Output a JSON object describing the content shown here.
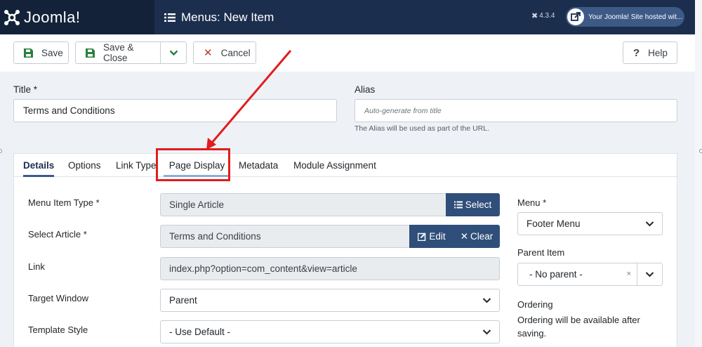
{
  "header": {
    "brand": "Joomla!",
    "page_title": "Menus: New Item",
    "version": "4.3.4",
    "site_link": "Your Joomla! Site hosted wit..."
  },
  "toolbar": {
    "save": "Save",
    "save_close": "Save & Close",
    "cancel": "Cancel",
    "help": "Help"
  },
  "form": {
    "title_label": "Title *",
    "title_value": "Terms and Conditions",
    "alias_label": "Alias",
    "alias_placeholder": "Auto-generate from title",
    "alias_hint": "The Alias will be used as part of the URL."
  },
  "tabs": [
    "Details",
    "Options",
    "Link Type",
    "Page Display",
    "Metadata",
    "Module Assignment"
  ],
  "details": {
    "menu_item_type_label": "Menu Item Type *",
    "menu_item_type_value": "Single Article",
    "select_button": "Select",
    "select_article_label": "Select Article *",
    "select_article_value": "Terms and Conditions",
    "edit_button": "Edit",
    "clear_button": "Clear",
    "link_label": "Link",
    "link_value": "index.php?option=com_content&view=article",
    "target_window_label": "Target Window",
    "target_window_value": "Parent",
    "template_style_label": "Template Style",
    "template_style_value": "- Use Default -"
  },
  "sidebar": {
    "menu_label": "Menu *",
    "menu_value": "Footer Menu",
    "parent_item_label": "Parent Item",
    "parent_item_value": "- No parent -",
    "ordering_label": "Ordering",
    "ordering_text": "Ordering will be available after saving."
  },
  "colors": {
    "header_bg": "#1c2e4e",
    "accent": "#2f4e7a",
    "annotation": "#e11d1d"
  }
}
